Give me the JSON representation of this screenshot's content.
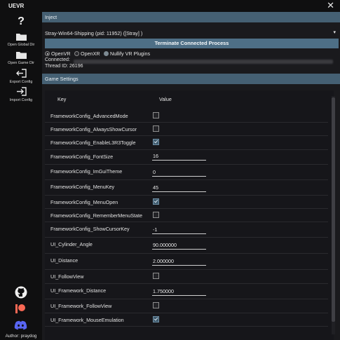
{
  "window": {
    "title": "UEVR"
  },
  "sidebar": {
    "items": [
      {
        "label": "Open Global Dir",
        "icon": "folder-icon"
      },
      {
        "label": "Open Game Dir",
        "icon": "folder-icon"
      },
      {
        "label": "Export Config",
        "icon": "export-icon"
      },
      {
        "label": "Import Config",
        "icon": "import-icon"
      }
    ],
    "help_icon": "?",
    "author": "Author: praydog"
  },
  "inject": {
    "header": "Inject",
    "process_value": "Stray-Win64-Shipping (pid: 11952) ([Stray]  )",
    "terminate_label": "Terminate Connected Process",
    "runtime_options": [
      {
        "label": "OpenVR",
        "selected": true
      },
      {
        "label": "OpenXR",
        "selected": false
      },
      {
        "label": "Nullify VR Plugins",
        "selected": false
      }
    ],
    "connected_label": "Connected:",
    "thread_label": "Thread ID: 26196"
  },
  "game_settings": {
    "header": "Game Settings",
    "columns": {
      "key": "Key",
      "value": "Value"
    },
    "rows": [
      {
        "key": "FrameworkConfig_AdvancedMode",
        "type": "checkbox",
        "checked": false
      },
      {
        "key": "FrameworkConfig_AlwaysShowCursor",
        "type": "checkbox",
        "checked": false
      },
      {
        "key": "FrameworkConfig_EnableL3R3Toggle",
        "type": "checkbox",
        "checked": true
      },
      {
        "key": "FrameworkConfig_FontSize",
        "type": "text",
        "value": "16"
      },
      {
        "key": "FrameworkConfig_ImGuiTheme",
        "type": "text",
        "value": "0"
      },
      {
        "key": "FrameworkConfig_MenuKey",
        "type": "text",
        "value": "45"
      },
      {
        "key": "FrameworkConfig_MenuOpen",
        "type": "checkbox",
        "checked": true
      },
      {
        "key": "FrameworkConfig_RememberMenuState",
        "type": "checkbox",
        "checked": false
      },
      {
        "key": "FrameworkConfig_ShowCursorKey",
        "type": "text",
        "value": "-1"
      },
      {
        "key": "UI_Cylinder_Angle",
        "type": "text",
        "value": "90.000000"
      },
      {
        "key": "UI_Distance",
        "type": "text",
        "value": "2.000000"
      },
      {
        "key": "UI_FollowView",
        "type": "checkbox",
        "checked": false
      },
      {
        "key": "UI_Framework_Distance",
        "type": "text",
        "value": "1.750000"
      },
      {
        "key": "UI_Framework_FollowView",
        "type": "checkbox",
        "checked": false
      },
      {
        "key": "UI_Framework_MouseEmulation",
        "type": "checkbox",
        "checked": true
      }
    ]
  },
  "colors": {
    "header_bg": "#456073",
    "button_bg": "#4e6f86",
    "panel_bg": "#1a1a1d",
    "sidebar_bg": "#0f0f10",
    "patreon": "#f96854",
    "discord": "#5865f2"
  },
  "icons": [
    "close-icon",
    "help-icon",
    "github-icon",
    "patreon-icon",
    "discord-icon"
  ]
}
